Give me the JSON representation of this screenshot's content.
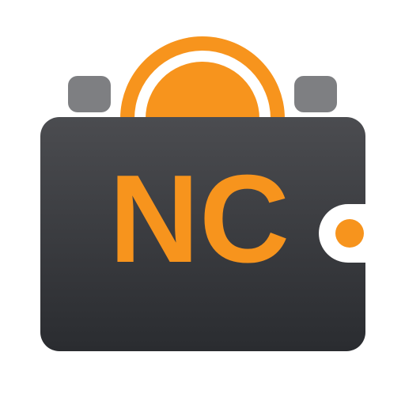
{
  "logo": {
    "text": "NC",
    "colors": {
      "orange": "#F7941D",
      "wallet_dark_top": "#4B4C50",
      "wallet_dark_bottom": "#2A2C30",
      "flap_gray": "#7E7F82",
      "background": "#FFFFFF"
    },
    "icons": {
      "coin": "coin-icon",
      "clasp": "clasp-icon",
      "wallet": "wallet-icon"
    }
  }
}
